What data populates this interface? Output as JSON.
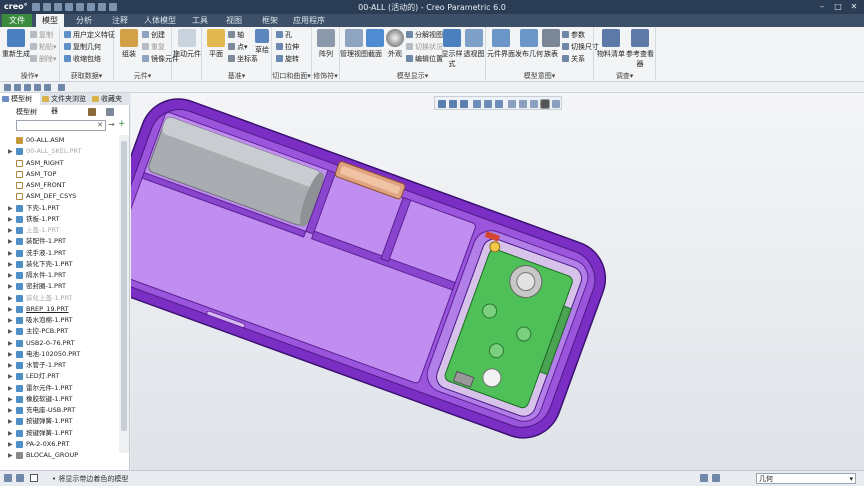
{
  "app": {
    "logo": "creo°",
    "title": "00-ALL (活动的) - Creo Parametric 6.0"
  },
  "tabs": [
    "文件",
    "模型",
    "分析",
    "注释",
    "人体模型",
    "工具",
    "视图",
    "框架",
    "应用程序"
  ],
  "ribbon": {
    "groups": [
      {
        "label": "操作▾",
        "big": [
          "重新生成"
        ],
        "small": [
          "复制",
          "粘贴▾",
          "删除▾"
        ]
      },
      {
        "label": "获取数据▾",
        "small": [
          "用户定义特征",
          "复制几何",
          "收缩包络"
        ]
      },
      {
        "label": "元件▾",
        "big": [
          "组装"
        ],
        "small": [
          "创建",
          "重复",
          "镜像元件"
        ]
      },
      {
        "label": "",
        "big": [
          "拖动元件"
        ]
      },
      {
        "label": "基准▾",
        "big": [
          "平面"
        ],
        "small": [
          "轴",
          "点▾",
          "坐标系"
        ],
        "extra": "草绘"
      },
      {
        "label": "切口和曲面▾",
        "small": [
          "孔",
          "拉伸",
          "旋转"
        ]
      },
      {
        "label": "修饰符▾",
        "big": [
          "阵列"
        ]
      },
      {
        "label": "模型显示▾",
        "big": [
          "管理视图",
          "截面",
          "外观",
          "显示样式",
          "透视图"
        ],
        "small": [
          "分解视图",
          "切换状况",
          "编辑位置"
        ]
      },
      {
        "label": "模型意图▾",
        "big": [
          "元件界面",
          "发布几何",
          "族表"
        ],
        "small": [
          "参数",
          "切换尺寸",
          "关系"
        ]
      },
      {
        "label": "调查▾",
        "big": [
          "物料清单",
          "参考查看器"
        ]
      }
    ]
  },
  "panel": {
    "tabs": [
      "模型树",
      "文件夹浏览器",
      "收藏夹"
    ],
    "toolbar_label": "模型树",
    "search_value": "",
    "tree": [
      {
        "label": "00-ALL.ASM",
        "type": "asm",
        "expand": false,
        "dim": false
      },
      {
        "label": "00-ALL_SKEL.PRT",
        "type": "part",
        "expand": true,
        "dim": true
      },
      {
        "label": "ASM_RIGHT",
        "type": "plane",
        "expand": false,
        "dim": false
      },
      {
        "label": "ASM_TOP",
        "type": "plane",
        "expand": false,
        "dim": false
      },
      {
        "label": "ASM_FRONT",
        "type": "plane",
        "expand": false,
        "dim": false
      },
      {
        "label": "ASM_DEF_CSYS",
        "type": "csys",
        "expand": false,
        "dim": false
      },
      {
        "label": "下壳-1.PRT",
        "type": "part",
        "expand": true,
        "dim": false
      },
      {
        "label": "铁板-1.PRT",
        "type": "part",
        "expand": true,
        "dim": false
      },
      {
        "label": "上盖-1.PRT",
        "type": "part",
        "expand": true,
        "dim": true
      },
      {
        "label": "装配件-1.PRT",
        "type": "part",
        "expand": true,
        "dim": false
      },
      {
        "label": "洗手液-1.PRT",
        "type": "part",
        "expand": true,
        "dim": false
      },
      {
        "label": "装化下壳-1.PRT",
        "type": "part",
        "expand": true,
        "dim": false
      },
      {
        "label": "隔水件-1.PRT",
        "type": "part",
        "expand": true,
        "dim": false
      },
      {
        "label": "密封圈-1.PRT",
        "type": "part",
        "expand": true,
        "dim": false
      },
      {
        "label": "装化上盖-1.PRT",
        "type": "part",
        "expand": true,
        "dim": true
      },
      {
        "label": "BREP_19.PRT",
        "type": "part",
        "expand": true,
        "dim": false,
        "underline": true
      },
      {
        "label": "吸水泡棉-1.PRT",
        "type": "part",
        "expand": true,
        "dim": false
      },
      {
        "label": "主控-PCB.PRT",
        "type": "part",
        "expand": true,
        "dim": false
      },
      {
        "label": "USB2-0-76.PRT",
        "type": "part",
        "expand": true,
        "dim": false
      },
      {
        "label": "电池-102050.PRT",
        "type": "part",
        "expand": true,
        "dim": false
      },
      {
        "label": "水管子-1.PRT",
        "type": "part",
        "expand": true,
        "dim": false
      },
      {
        "label": "LED灯.PRT",
        "type": "part",
        "expand": true,
        "dim": false
      },
      {
        "label": "雷尔元件-1.PRT",
        "type": "part",
        "expand": true,
        "dim": false
      },
      {
        "label": "橡胶软键-1.PRT",
        "type": "part",
        "expand": true,
        "dim": false
      },
      {
        "label": "充电座-USB.PRT",
        "type": "part",
        "expand": true,
        "dim": false
      },
      {
        "label": "按键弹簧-1.PRT",
        "type": "part",
        "expand": true,
        "dim": false
      },
      {
        "label": "按键弹簧-1.PRT",
        "type": "part",
        "expand": true,
        "dim": false
      },
      {
        "label": "PA-2-0X6.PRT",
        "type": "part",
        "expand": true,
        "dim": false
      },
      {
        "label": "BLOCAL_GROUP",
        "type": "group",
        "expand": true,
        "dim": false
      }
    ]
  },
  "status": {
    "message": "• 将显示带边着色的模型",
    "filter": "几何"
  },
  "colors": {
    "title_bg": "#2b3d55",
    "file_tab": "#3a8b3e",
    "shell_purple": "#8a3fcf",
    "shell_light": "#c99cf0",
    "pcb_green": "#4fbf57",
    "battery_grey": "#a9acb0"
  }
}
